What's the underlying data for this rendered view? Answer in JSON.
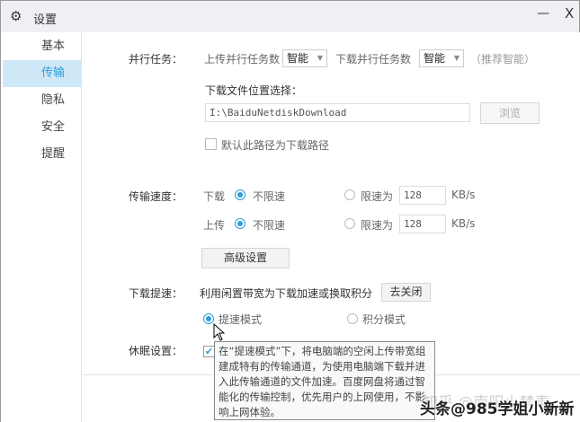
{
  "window": {
    "title": "设置",
    "minimize": "—",
    "close": "X"
  },
  "sidebar": {
    "items": [
      {
        "label": "基本"
      },
      {
        "label": "传输"
      },
      {
        "label": "隐私"
      },
      {
        "label": "安全"
      },
      {
        "label": "提醒"
      }
    ],
    "active": "传输"
  },
  "parallel": {
    "label": "并行任务：",
    "upload_label": "上传并行任务数",
    "upload_value": "智能",
    "download_label": "下载并行任务数",
    "download_value": "智能",
    "hint": "（推荐智能）"
  },
  "location": {
    "label": "下载文件位置选择：",
    "path": "I:\\BaiduNetdiskDownload",
    "browse": "浏览",
    "default_checkbox": "默认此路径为下载路径",
    "default_checked": false
  },
  "speed": {
    "label": "传输速度：",
    "download": "下载",
    "upload": "上传",
    "unlimited": "不限速",
    "limit": "限速为",
    "download_limit": "128",
    "upload_limit": "128",
    "unit": "KB/s",
    "advanced": "高级设置"
  },
  "boost": {
    "label": "下载提速：",
    "desc": "利用闲置带宽为下载加速或换取积分",
    "close_btn": "去关闭",
    "mode_speed": "提速模式",
    "mode_points": "积分模式",
    "selected": "提速模式"
  },
  "sleep": {
    "label": "休眠设置：",
    "checked": true
  },
  "tooltip": {
    "text": "在“提速模式”下，将电脑端的空闲上传带宽组建成特有的传输通道，为使用电脑端下载并进入此传输通道的文件加速。百度网盘将通过智能化的传输控制，优先用户的上网使用，不影响上网体验。"
  },
  "watermark": {
    "line1": "知乎 @南阳小禁毒",
    "line2": "头条@985学姐小新新"
  },
  "colors": {
    "accent": "#2a9fd8",
    "active_bg": "#cfe8f7"
  }
}
